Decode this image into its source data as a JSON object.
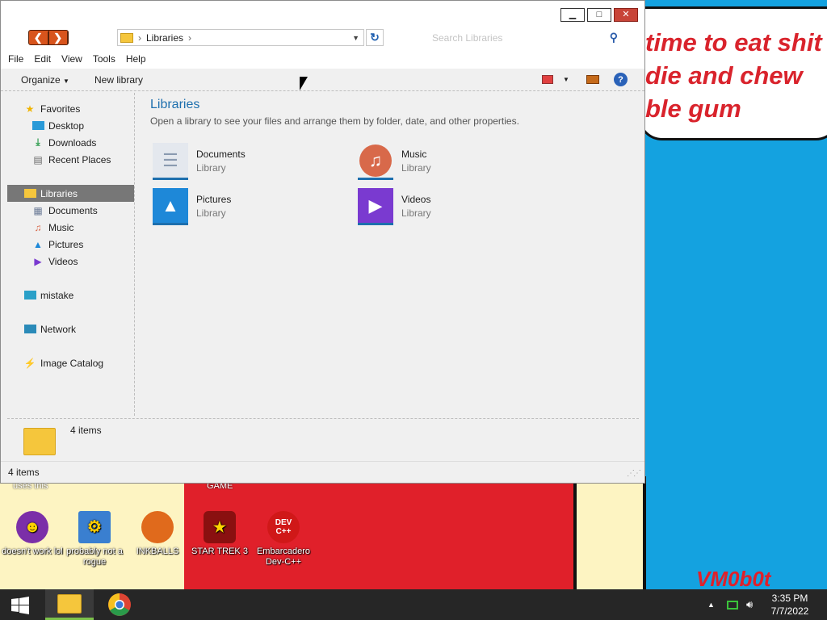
{
  "desktop": {
    "meme_text": "time to eat shit\ndie and chew\nble gum",
    "signature": "VM0b0t",
    "partial_labels": [
      "uses this",
      "GAME"
    ],
    "icons": [
      {
        "label": "doesn't work lol",
        "icon": "yahoo-messenger-icon",
        "color": "#7b2fa8"
      },
      {
        "label": "probably not a rogue",
        "icon": "gear-monitor-icon",
        "color": "#3a7fd0"
      },
      {
        "label": "INKBALLS",
        "icon": "inkball-icon",
        "color": "#e06a1c"
      },
      {
        "label": "STAR TREK 3",
        "icon": "star-trek-icon",
        "color": "#8a1010"
      },
      {
        "label": "Embarcadero Dev-C++",
        "icon": "devcpp-icon",
        "color": "#d01818",
        "glyph": "DEV C++"
      }
    ]
  },
  "window": {
    "address": {
      "root_label": "Libraries",
      "separator": "›"
    },
    "search_placeholder": "Search Libraries",
    "menu": [
      "File",
      "Edit",
      "View",
      "Tools",
      "Help"
    ],
    "toolbar": {
      "organize": "Organize",
      "new_library": "New library"
    },
    "nav": {
      "favorites": "Favorites",
      "desktop": "Desktop",
      "downloads": "Downloads",
      "recent": "Recent Places",
      "libraries": "Libraries",
      "documents": "Documents",
      "music": "Music",
      "pictures": "Pictures",
      "videos": "Videos",
      "computer": "mistake",
      "network": "Network",
      "image_catalog": "Image Catalog"
    },
    "content": {
      "heading": "Libraries",
      "subheading": "Open a library to see your files and arrange them by folder, date, and other properties.",
      "items": [
        {
          "name": "Documents",
          "type": "Library",
          "icon": "documents-library-icon",
          "color": "#a8b8cc"
        },
        {
          "name": "Music",
          "type": "Library",
          "icon": "music-library-icon",
          "color": "#d8694a"
        },
        {
          "name": "Pictures",
          "type": "Library",
          "icon": "pictures-library-icon",
          "color": "#1e88d8"
        },
        {
          "name": "Videos",
          "type": "Library",
          "icon": "videos-library-icon",
          "color": "#7a3ad0"
        }
      ]
    },
    "details": {
      "count": "4 items"
    },
    "status": {
      "count": "4 items"
    }
  },
  "taskbar": {
    "time": "3:35 PM",
    "date": "7/7/2022"
  },
  "colors": {
    "accent": "#1d6fae",
    "close": "#c84438",
    "taskbar": "#262626"
  }
}
